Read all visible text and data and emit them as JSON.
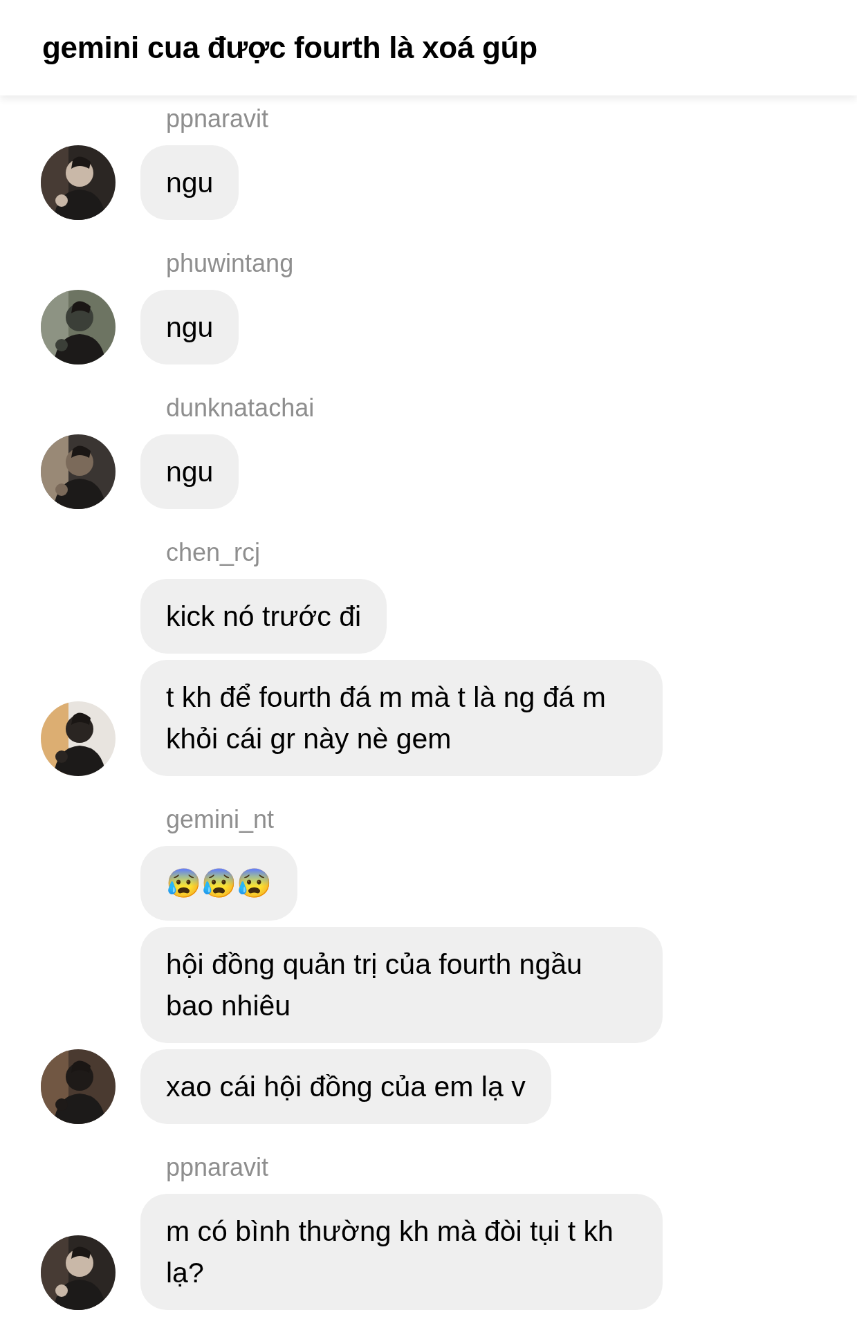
{
  "header": {
    "title": "gemini cua được fourth là xoá gúp"
  },
  "groups": [
    {
      "sender": "ppnaravit",
      "avatar": {
        "kind": "picture"
      },
      "messages": [
        {
          "text": "ngu"
        }
      ]
    },
    {
      "sender": "phuwintang",
      "avatar": {
        "kind": "picture"
      },
      "messages": [
        {
          "text": "ngu"
        }
      ]
    },
    {
      "sender": "dunknatachai",
      "avatar": {
        "kind": "picture"
      },
      "messages": [
        {
          "text": "ngu"
        }
      ]
    },
    {
      "sender": "chen_rcj",
      "avatar": {
        "kind": "picture"
      },
      "messages": [
        {
          "text": "kick nó trước đi"
        },
        {
          "text": "t kh để fourth đá m mà t là ng đá m khỏi cái gr này nè gem"
        }
      ]
    },
    {
      "sender": "gemini_nt",
      "avatar": {
        "kind": "picture"
      },
      "messages": [
        {
          "text": "😰😰😰"
        },
        {
          "text": "hội đồng quản trị của fourth ngầu bao nhiêu"
        },
        {
          "text": "xao cái hội đồng của em lạ v"
        }
      ]
    },
    {
      "sender": "ppnaravit",
      "avatar": {
        "kind": "picture"
      },
      "messages": [
        {
          "text": "m có bình thường kh mà đòi tụi t kh lạ?"
        }
      ]
    }
  ]
}
